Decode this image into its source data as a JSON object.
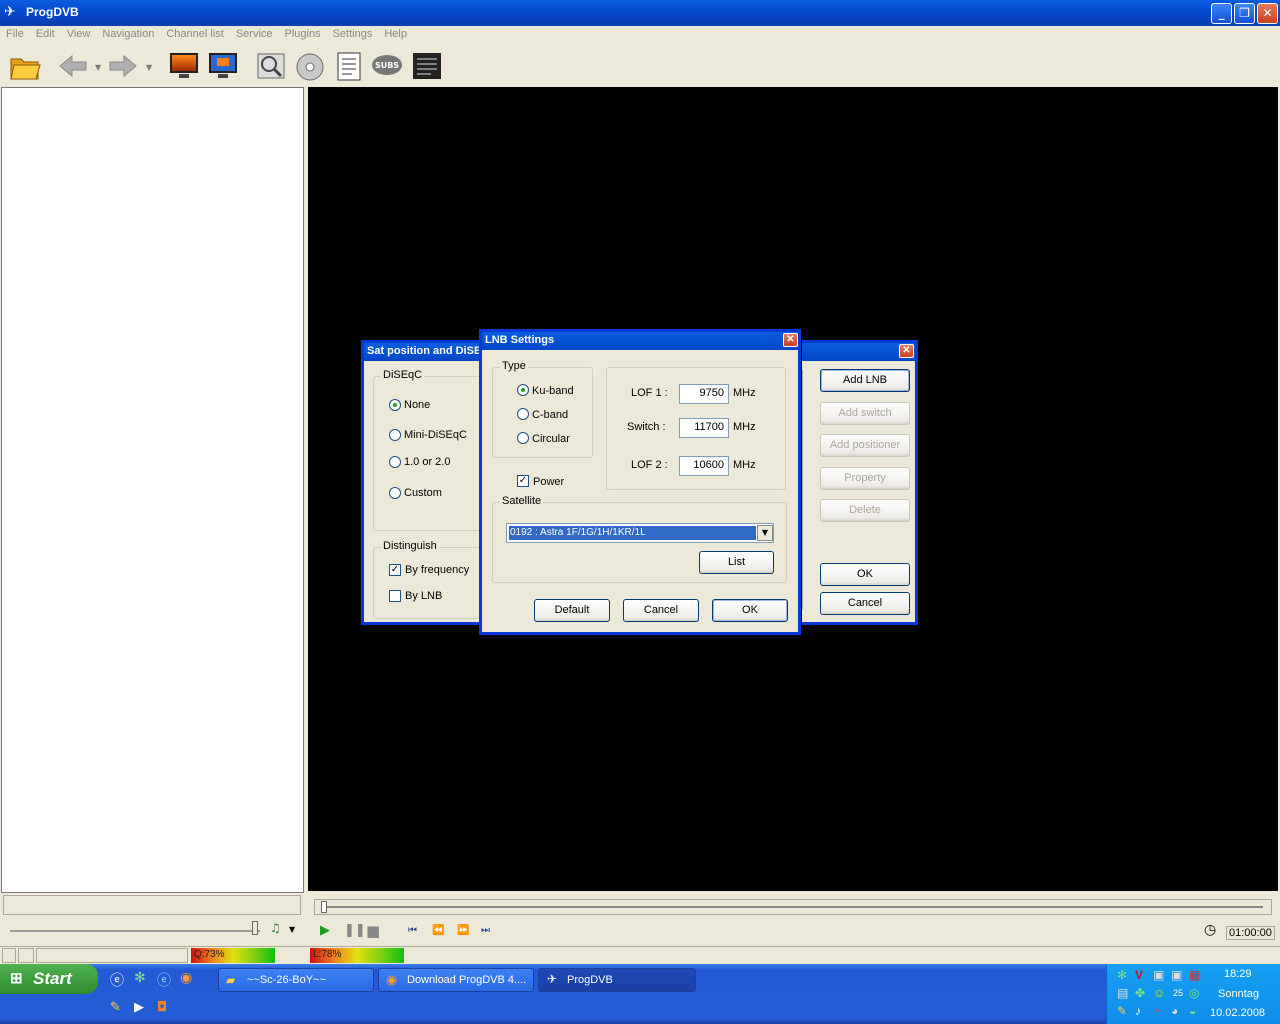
{
  "window": {
    "title": "ProgDVB"
  },
  "menu": [
    "File",
    "Edit",
    "View",
    "Navigation",
    "Channel list",
    "Service",
    "Plugins",
    "Settings",
    "Help"
  ],
  "toolbar": {
    "icons": [
      "open-folder-icon",
      "back-arrow-icon",
      "forward-arrow-icon",
      "monitor-orange-icon",
      "monitor-blue-icon",
      "scan-icon",
      "disc-icon",
      "epg-list-icon",
      "subs-icon",
      "teletext-icon"
    ],
    "subs_label": "SUBS"
  },
  "player": {
    "time": "01:00:00"
  },
  "status": {
    "quality": "Q:73%",
    "level": "L:78%",
    "quality_value": 73,
    "level_value": 78
  },
  "sat_dialog": {
    "title": "Sat position and DiSEqC",
    "diseqc_group": "DiSEqC",
    "diseqc_options": [
      "None",
      "Mini-DiSEqC",
      "1.0 or 2.0",
      "Custom"
    ],
    "diseqc_selected": "None",
    "distinguish_group": "Distinguish",
    "by_frequency": "By frequency",
    "by_lnb": "By LNB",
    "buttons": {
      "add_lnb": "Add LNB",
      "add_switch": "Add switch",
      "add_positioner": "Add positioner",
      "property": "Property",
      "delete": "Delete",
      "ok": "OK",
      "cancel": "Cancel"
    }
  },
  "lnb_dialog": {
    "title": "LNB Settings",
    "type_group": "Type",
    "type_options": [
      "Ku-band",
      "C-band",
      "Circular"
    ],
    "type_selected": "Ku-band",
    "lof1_label": "LOF 1 :",
    "lof1_value": "9750",
    "switch_label": "Switch :",
    "switch_value": "11700",
    "lof2_label": "LOF 2 :",
    "lof2_value": "10600",
    "unit": "MHz",
    "power_label": "Power",
    "power_checked": true,
    "satellite_group": "Satellite",
    "satellite_value": "0192 : Astra 1F/1G/1H/1KR/1L",
    "list_button": "List",
    "default_button": "Default",
    "cancel_button": "Cancel",
    "ok_button": "OK"
  },
  "taskbar": {
    "start": "Start",
    "tasks": [
      "~~Sc-26-BoY~~",
      "Download ProgDVB 4....",
      "ProgDVB"
    ],
    "clock": "18:29",
    "day": "Sonntag",
    "date": "10.02.2008",
    "tray_number": "25"
  }
}
